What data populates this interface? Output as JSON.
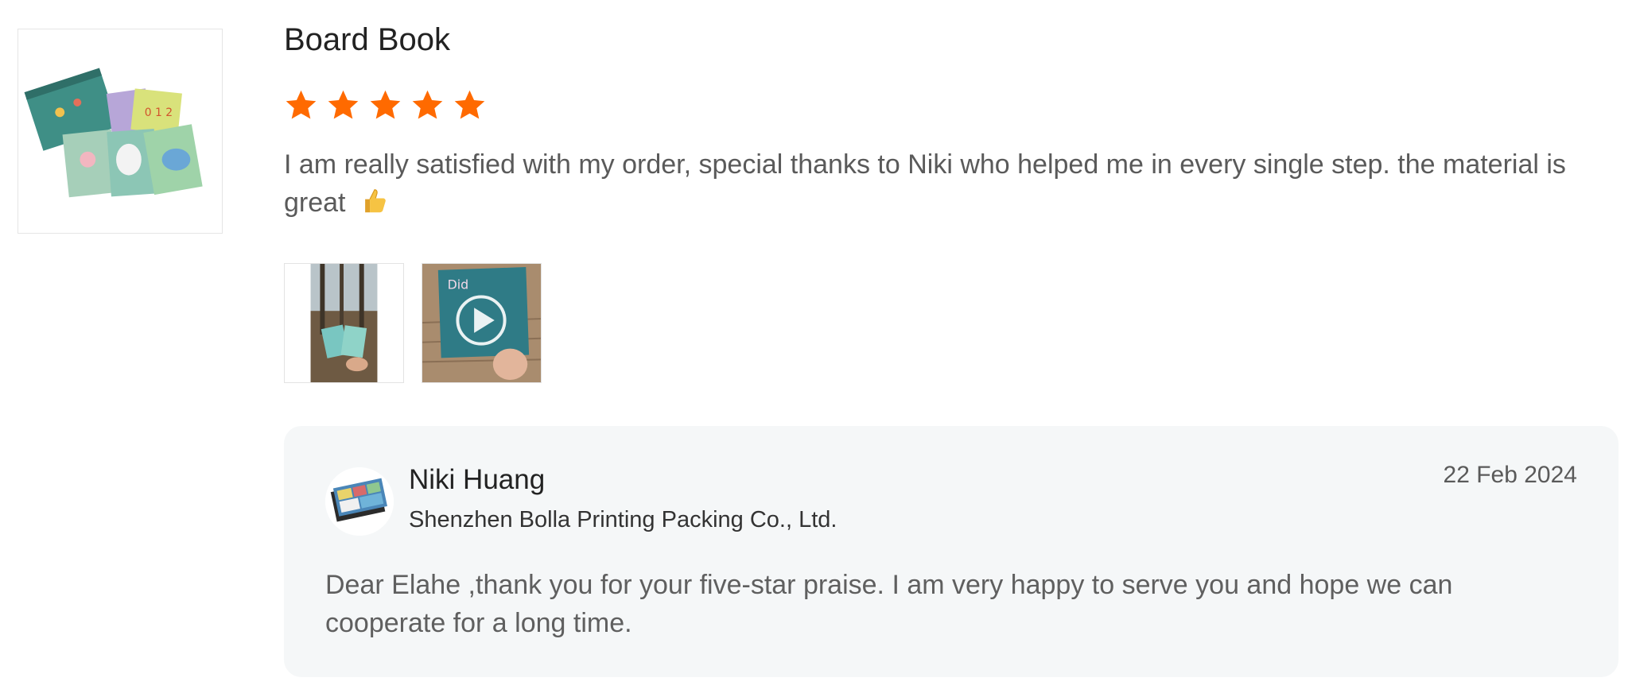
{
  "review": {
    "product_title": "Board Book",
    "rating": 5,
    "rating_max": 5,
    "star_color": "#ff6a00",
    "text": "I am really satisfied with my order, special thanks to Niki who helped me in every single step. the material is great",
    "emoji_icon": "thumbs-up-icon",
    "media": [
      {
        "type": "image",
        "icon": "image-thumbnail"
      },
      {
        "type": "video",
        "icon": "play-icon"
      }
    ]
  },
  "reply": {
    "seller_name": "Niki Huang",
    "seller_company": "Shenzhen Bolla Printing Packing Co., Ltd.",
    "date": "22 Feb 2024",
    "text": "Dear Elahe ,thank you for your five-star praise. I am very happy to serve you and hope we can cooperate for a long time.",
    "background": "#f5f7f8"
  }
}
